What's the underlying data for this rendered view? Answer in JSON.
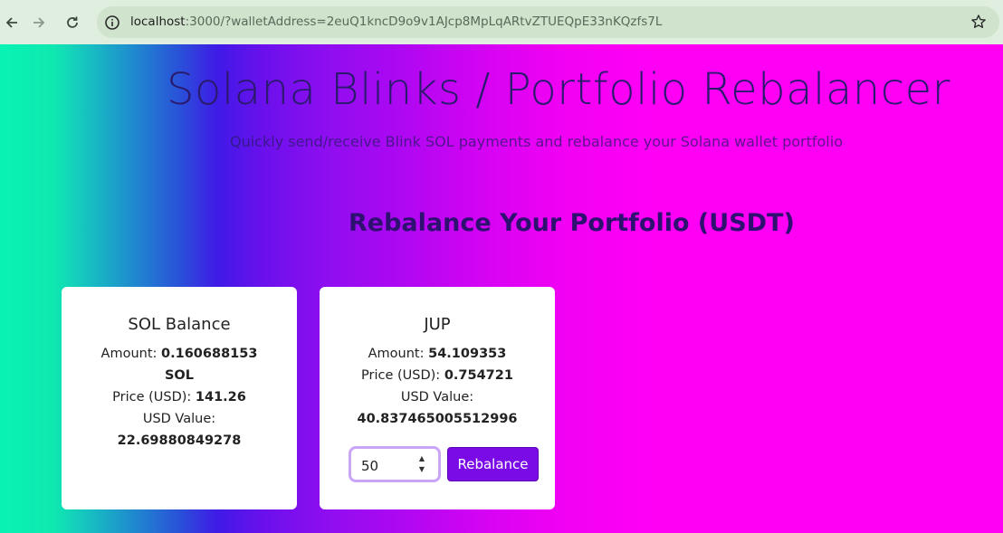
{
  "browser": {
    "url_host": "localhost",
    "url_rest": ":3000/?walletAddress=2euQ1kncD9o9v1AJcp8MpLqARtvZTUEQpE33nKQzfs7L",
    "icons": [
      "back-icon",
      "forward-icon",
      "reload-icon",
      "info-icon",
      "star-icon"
    ]
  },
  "header": {
    "title": "Solana Blinks / Portfolio Rebalancer",
    "subtitle": "Quickly send/receive Blink SOL payments and rebalance your Solana wallet portfolio"
  },
  "section": {
    "title": "Rebalance Your Portfolio (USDT)"
  },
  "cards": {
    "sol": {
      "title": "SOL Balance",
      "amount_label": "Amount:",
      "amount_value": "0.160688153",
      "amount_unit": "SOL",
      "price_label": "Price (USD):",
      "price_value": "141.26",
      "usd_label": "USD Value:",
      "usd_value": "22.69880849278"
    },
    "jup": {
      "title": "JUP",
      "amount_label": "Amount:",
      "amount_value": "54.109353",
      "price_label": "Price (USD):",
      "price_value": "0.754721",
      "usd_label": "USD Value:",
      "usd_value": "40.837465005512996",
      "input_value": "50",
      "button_label": "Rebalance"
    }
  },
  "colors": {
    "accent": "#7a0be6",
    "gradient_start": "#08f3b4",
    "gradient_end": "#ff00f5"
  }
}
